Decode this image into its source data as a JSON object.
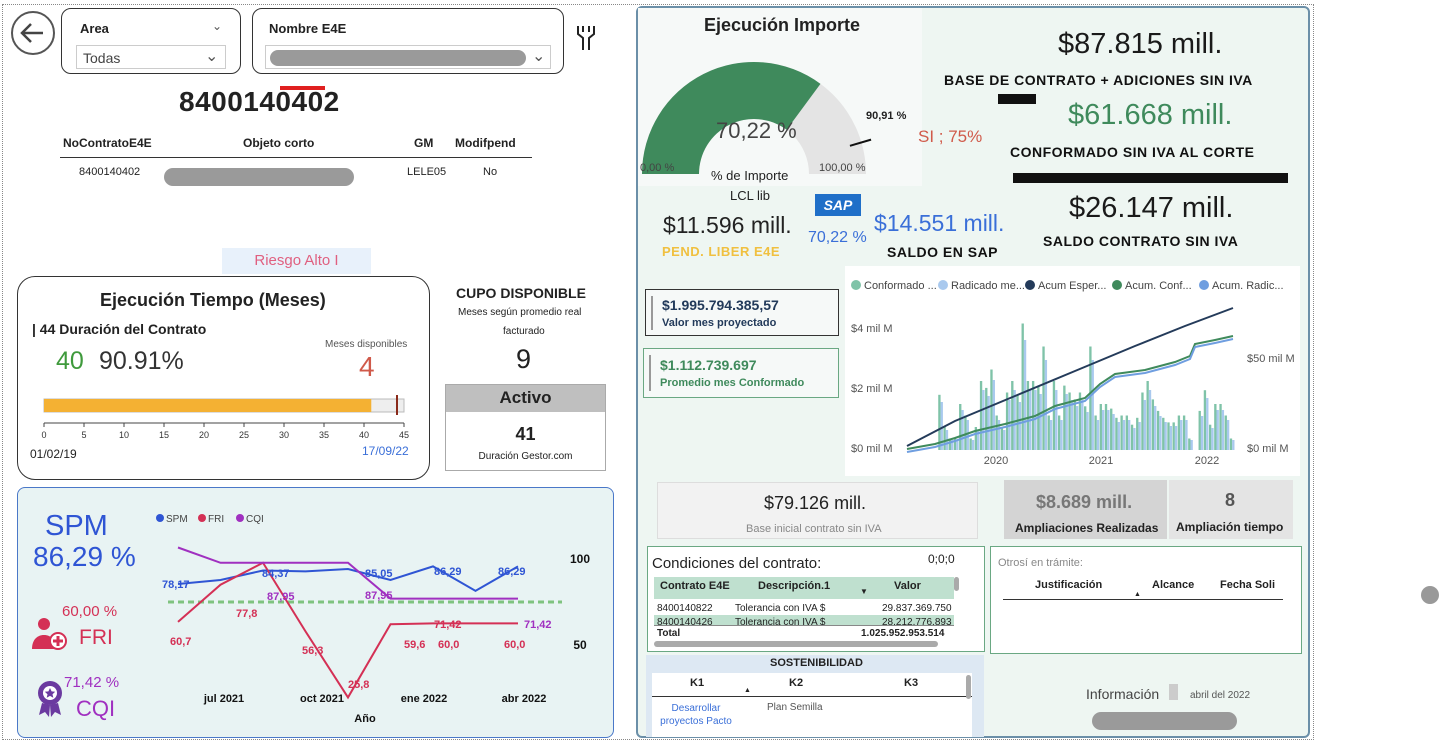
{
  "header": {
    "area_label": "Area",
    "area_value": "Todas",
    "nombre_label": "Nombre E4E",
    "contract_number": "8400140402"
  },
  "contract_table": {
    "columns": [
      "NoContratoE4E",
      "Objeto corto",
      "GM",
      "Modifpend"
    ],
    "row": {
      "no": "8400140402",
      "gm": "LELE05",
      "modif": "No"
    }
  },
  "risk_badge": "Riesgo Alto I",
  "tiempo": {
    "title": "Ejecución Tiempo (Meses)",
    "duracion": "| 44 Duración del Contrato",
    "elapsed": "40",
    "percent": "90.91%",
    "meses_disp_label": "Meses disponibles",
    "meses_disp_value": "4",
    "progress_fraction": 0.9091,
    "scale_ticks": [
      "0",
      "5",
      "10",
      "15",
      "20",
      "25",
      "30",
      "35",
      "40",
      "45"
    ],
    "start_date": "01/02/19",
    "end_date": "17/09/22"
  },
  "cupo": {
    "title": "CUPO DISPONIBLE",
    "subtitle_line1": "Meses según promedio real",
    "subtitle_line2": "facturado",
    "value": "9"
  },
  "activo": {
    "label": "Activo",
    "value": "41",
    "sub": "Duración Gestor.com"
  },
  "indicators": {
    "spm_label": "SPM",
    "spm_value": "86,29 %",
    "fri_value": "60,00 %",
    "fri_label": "FRI",
    "cqi_value": "71,42 %",
    "cqi_label": "CQI"
  },
  "chart_data": [
    {
      "type": "line",
      "xlabel": "Año",
      "x_ticks": [
        "jul 2021",
        "oct 2021",
        "ene 2022",
        "abr 2022"
      ],
      "y_ticks": [
        "100",
        "50"
      ],
      "legend": [
        "SPM",
        "FRI",
        "CQI"
      ],
      "series": [
        {
          "name": "SPM",
          "color": "#2f55d4",
          "values": [
            78.17,
            80,
            84.37,
            84,
            85.05,
            80,
            86.29,
            75,
            86.29
          ]
        },
        {
          "name": "FRI",
          "color": "#d43055",
          "values": [
            60.7,
            77.8,
            87.95,
            56.3,
            25.8,
            59.6,
            60.0,
            60.0,
            60.0
          ]
        },
        {
          "name": "CQI",
          "color": "#a030c0",
          "values": [
            95,
            87.95,
            87.95,
            87.95,
            87.95,
            71.42,
            71.42,
            71.42,
            71.42
          ]
        }
      ],
      "data_labels": [
        "78,17",
        "84,37",
        "85,05",
        "86,29",
        "86,29",
        "87,95",
        "87,95",
        "77,8",
        "60,7",
        "56,3",
        "25,8",
        "59,6",
        "60,0",
        "71,42",
        "60,0",
        "71,42"
      ]
    },
    {
      "type": "bar",
      "legend": [
        "Conformado ...",
        "Radicado me...",
        "Acum Esper...",
        "Acum. Conf...",
        "Acum. Radic..."
      ],
      "y_left_ticks": [
        "$4 mil M",
        "$2 mil M",
        "$0 mil M"
      ],
      "y_right_ticks": [
        "$50 mil M",
        "$0 mil M"
      ],
      "x_ticks": [
        "2020",
        "2021",
        "2022"
      ],
      "colors": [
        "#7fc3a8",
        "#a9c9ee",
        "#243b5a",
        "#3f8a5c",
        "#6f9ee0"
      ]
    }
  ],
  "ejecucion_importe": {
    "title": "Ejecución Importe",
    "gauge_value": "70,22 %",
    "gauge_fraction": 0.7022,
    "gauge_target": "90,91 %",
    "gauge_min": "0,00 %",
    "gauge_max": "100,00 %",
    "si_label": "SI ; 75%",
    "sub_label_1": "% de Importe",
    "sub_label_2": "LCL lib"
  },
  "kpis": {
    "base_contrato": "$87.815 mill.",
    "base_contrato_label": "BASE DE CONTRATO + ADICIONES SIN IVA",
    "conformado": "$61.668 mill.",
    "conformado_label": "CONFORMADO SIN IVA AL CORTE",
    "pend_liber": "$11.596 mill.",
    "pend_liber_label": "PEND. LIBER E4E",
    "sap_logo": "SAP",
    "sap_pct": "70,22 %",
    "saldo_sap": "$14.551 mill.",
    "saldo_sap_label": "SALDO EN SAP",
    "saldo_contrato": "$26.147 mill.",
    "saldo_contrato_label": "SALDO CONTRATO SIN IVA",
    "valor_mes": "$1.995.794.385,57",
    "valor_mes_label": "Valor mes proyectado",
    "promedio_mes": "$1.112.739.697",
    "promedio_mes_label": "Promedio mes Conformado",
    "base_inicial": "$79.126 mill.",
    "base_inicial_label": "Base inicial contrato sin IVA",
    "ampliaciones": "$8.689 mill.",
    "ampliaciones_label": "Ampliaciones Realizadas",
    "ampliacion_tiempo": "8",
    "ampliacion_tiempo_label": "Ampliación tiempo"
  },
  "condiciones": {
    "title": "Condiciones del contrato:",
    "counter": "0;0;0",
    "columns": [
      "Contrato E4E",
      "Descripción.1",
      "Valor"
    ],
    "rows": [
      [
        "8400140822",
        "Tolerancia con IVA $",
        "29.837.369.750"
      ],
      [
        "8400140426",
        "Tolerancia con IVA $",
        "28.212.776.893"
      ]
    ],
    "total_label": "Total",
    "total_value": "1.025.952.953.514"
  },
  "otrosi": {
    "title": "Otrosí en trámite:",
    "columns": [
      "Justificación",
      "Alcance",
      "Fecha Soli"
    ]
  },
  "sostenibilidad": {
    "title": "SOSTENIBILIDAD",
    "columns": [
      "K1",
      "K2",
      "K3"
    ],
    "row": [
      "Desarrollar proyectos Pacto",
      "Plan Semilla",
      ""
    ]
  },
  "informacion": {
    "label": "Información",
    "date": "abril del 2022"
  }
}
